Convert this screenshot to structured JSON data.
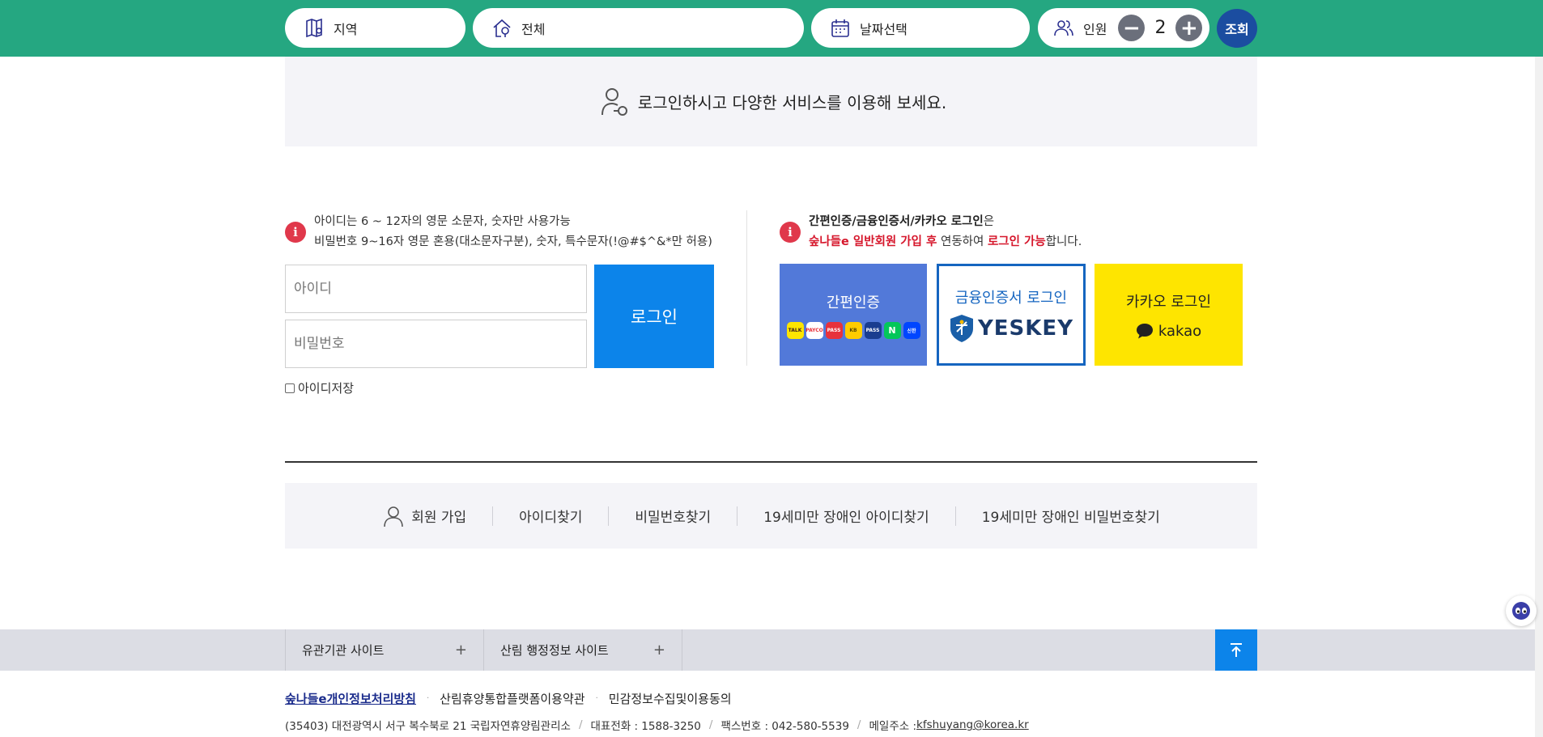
{
  "search": {
    "region_label": "지역",
    "type_label": "전체",
    "date_label": "날짜선택",
    "person_label": "인원",
    "minus": "−",
    "plus": "+",
    "count": "2",
    "submit_label": "조회"
  },
  "banner": {
    "text": "로그인하시고 다양한 서비스를 이용해 보세요."
  },
  "notice_left": {
    "line1": "아이디는 6 ~ 12자의 영문 소문자, 숫자만 사용가능",
    "line2": "비밀번호 9~16자 영문 혼용(대소문자구분), 숫자, 특수문자(!@#$^&*만 허용)"
  },
  "notice_right": {
    "bold1": "간편인증/금융인증서/카카오 로그인",
    "text1": "은",
    "red1": "숲나들e 일반회원 가입 후",
    "text2": " 연동하여 ",
    "red2": "로그인 가능",
    "text3": "합니다."
  },
  "login_form": {
    "id_placeholder": "아이디",
    "pw_placeholder": "비밀번호",
    "login_label": "로그인",
    "save_id_label": "아이디저장"
  },
  "auth": {
    "simple_label": "간편인증",
    "simple_logos": [
      {
        "text": "TALK",
        "bg": "#fee500",
        "color": "#3c1e1e"
      },
      {
        "text": "PAYCO",
        "bg": "#ffffff",
        "color": "#e8323c"
      },
      {
        "text": "PASS",
        "bg": "#e8323c",
        "color": "#ffffff"
      },
      {
        "text": "KB",
        "bg": "#ffcc00",
        "color": "#5a4a00"
      },
      {
        "text": "PASS",
        "bg": "#1a3d8f",
        "color": "#ffffff"
      },
      {
        "text": "N",
        "bg": "#03c75a",
        "color": "#ffffff"
      },
      {
        "text": "신한",
        "bg": "#0046ff",
        "color": "#ffffff"
      }
    ],
    "cert_label": "금융인증서 로그인",
    "cert_logo_text": "YESKEY",
    "kakao_label": "카카오 로그인",
    "kakao_logo_text": "kakao"
  },
  "links": {
    "signup": "회원 가입",
    "find_id": "아이디찾기",
    "find_pw": "비밀번호찾기",
    "minor_find_id": "19세미만 장애인 아이디찾기",
    "minor_find_pw": "19세미만 장애인 비밀번호찾기"
  },
  "footer": {
    "related_sites": "유관기관 사이트",
    "forest_admin_sites": "산림 행정정보 사이트",
    "privacy_policy": "숲나들e개인정보처리방침",
    "terms": "산림휴양통합플랫폼이용약관",
    "consent": "민감정보수집및이용동의",
    "address": "(35403) 대전광역시 서구 복수북로 21 국립자연휴양림관리소",
    "phone": "대표전화 : 1588-3250",
    "fax": "팩스번호 : 042-580-5539",
    "email_label": "메일주소 : ",
    "email": "kfshuyang@korea.kr"
  },
  "colors": {
    "topbar": "#25a781",
    "search_button": "#1b4da0",
    "login_button": "#0c84ea",
    "simple_auth": "#5279d9",
    "cert_border": "#1565c0",
    "kakao": "#fee500",
    "notice_icon": "#e0384b",
    "notice_red": "#d6162b"
  }
}
